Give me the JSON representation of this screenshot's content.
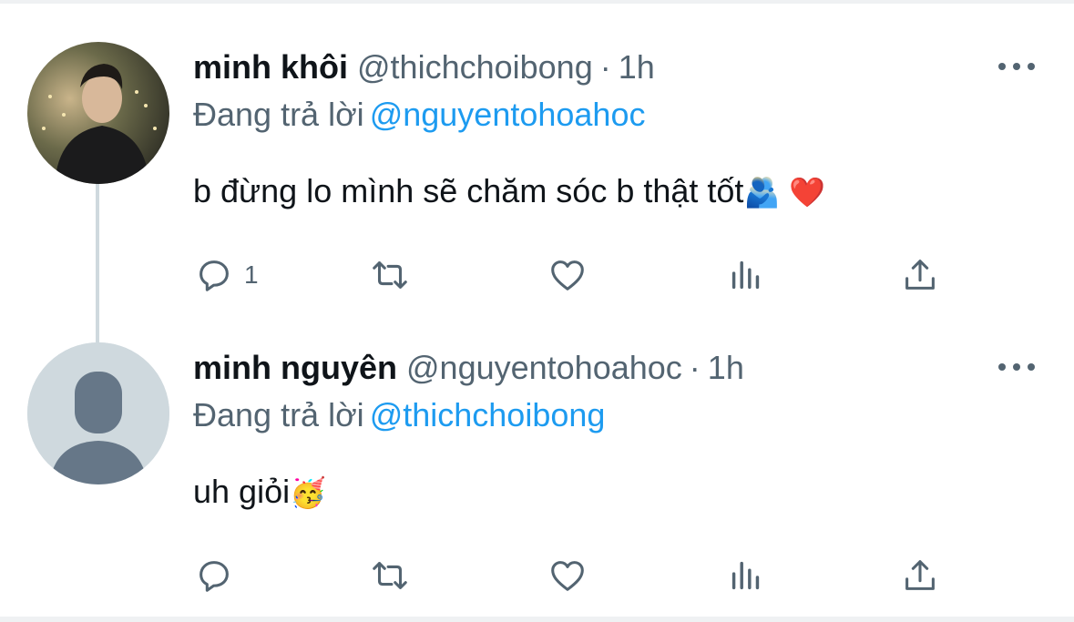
{
  "tweets": [
    {
      "display_name": "minh khôi",
      "handle": "@thichchoibong",
      "separator": "·",
      "time": "1h",
      "reply_prefix": "Đang trả lời",
      "reply_to": "@nguyentohoahoc",
      "text": "b đừng lo mình sẽ chăm sóc b thật tốt",
      "emoji_1": "🫂",
      "emoji_2": "❤️",
      "reply_count": "1"
    },
    {
      "display_name": "minh nguyên",
      "handle": "@nguyentohoahoc",
      "separator": "·",
      "time": "1h",
      "reply_prefix": "Đang trả lời",
      "reply_to": "@thichchoibong",
      "text": "uh giỏi",
      "emoji_1": "🥳",
      "reply_count": ""
    }
  ],
  "icons": {
    "reply": "speech-bubble-icon",
    "retweet": "retweet-arrows-icon",
    "like": "heart-outline-icon",
    "views": "bar-chart-icon",
    "share": "upload-arrow-icon",
    "more": "three-dots-icon"
  },
  "colors": {
    "text": "#0f1419",
    "secondary": "#536471",
    "link": "#1d9bf0",
    "default_avatar": "#cfd9de",
    "thread_line": "#cfd9de"
  }
}
